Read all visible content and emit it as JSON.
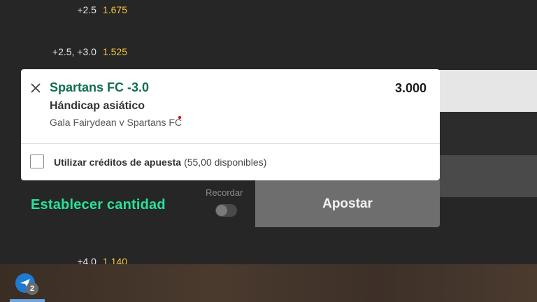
{
  "background_rows": [
    {
      "line": "+2.5",
      "odds": "1.675"
    },
    {
      "line": "+2.5, +3.0",
      "odds": "1.525"
    },
    {
      "line": "+4.0",
      "odds": "1.140"
    }
  ],
  "betslip": {
    "selection": "Spartans FC -3.0",
    "odds": "3.000",
    "market": "Hándicap asiático",
    "event": "Gala Fairydean v Spartans FC",
    "credits_label": "Utilizar créditos de apuesta",
    "credits_available": "(55,00 disponibles)",
    "credits_checked": false
  },
  "stake": {
    "set_amount_label": "Establecer cantidad",
    "remember_label": "Recordar",
    "remember_enabled": false,
    "bet_button_label": "Apostar"
  },
  "taskbar": {
    "bet_count": "2"
  },
  "colors": {
    "accent_green": "#27e29a",
    "selection_green": "#126e51",
    "odds_yellow": "#f5c242"
  }
}
